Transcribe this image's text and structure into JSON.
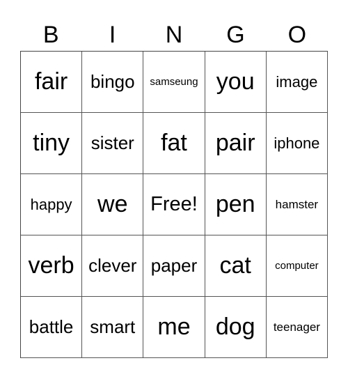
{
  "header": {
    "letters": [
      "B",
      "I",
      "N",
      "G",
      "O"
    ]
  },
  "board": {
    "rows": [
      [
        "fair",
        "bingo",
        "samseung",
        "you",
        "image"
      ],
      [
        "tiny",
        "sister",
        "fat",
        "pair",
        "iphone"
      ],
      [
        "happy",
        "we",
        "Free!",
        "pen",
        "hamster"
      ],
      [
        "verb",
        "clever",
        "paper",
        "cat",
        "computer"
      ],
      [
        "battle",
        "smart",
        "me",
        "dog",
        "teenager"
      ]
    ]
  }
}
